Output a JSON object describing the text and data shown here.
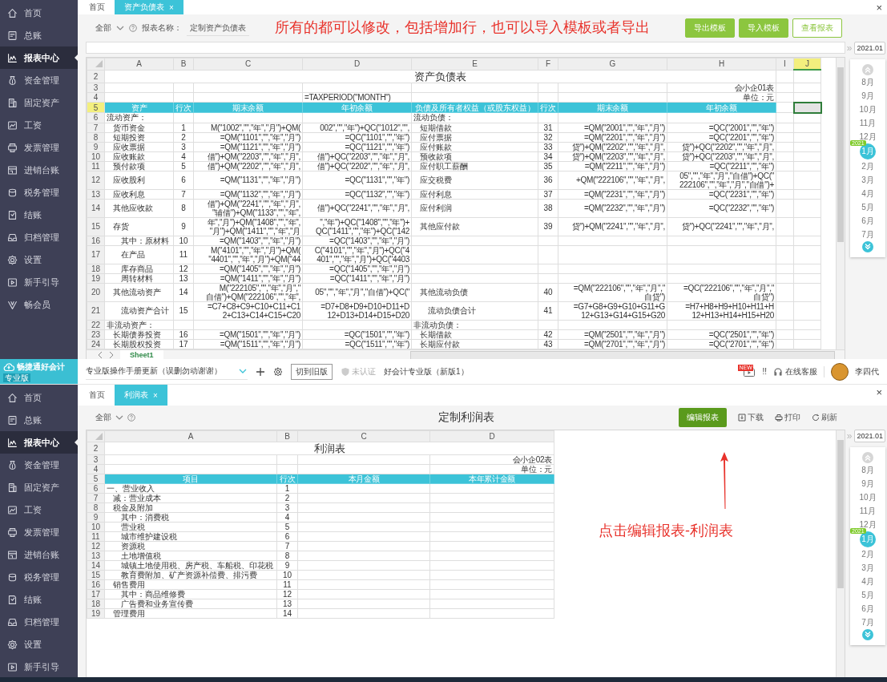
{
  "top": {
    "sidebar": [
      {
        "label": "首页",
        "selected": false
      },
      {
        "label": "总账",
        "selected": false
      },
      {
        "label": "报表中心",
        "selected": true
      },
      {
        "label": "资金管理",
        "selected": false
      },
      {
        "label": "固定资产",
        "selected": false
      },
      {
        "label": "工资",
        "selected": false
      },
      {
        "label": "发票管理",
        "selected": false
      },
      {
        "label": "进销台账",
        "selected": false
      },
      {
        "label": "税务管理",
        "selected": false
      },
      {
        "label": "结账",
        "selected": false
      },
      {
        "label": "归档管理",
        "selected": false
      },
      {
        "label": "设置",
        "selected": false
      },
      {
        "label": "新手引导",
        "selected": false
      },
      {
        "label": "畅会员",
        "selected": false
      }
    ],
    "tabs": [
      {
        "label": "首页",
        "selected": false
      },
      {
        "label": "资产负债表",
        "selected": true,
        "close": "×"
      }
    ],
    "close": "×",
    "toolbar": {
      "scope": "全部",
      "report_label": "报表名称：",
      "report_name": "定制资产负债表",
      "annotation": "所有的都可以修改，包括增加行，也可以导入模板或者导出",
      "buttons": [
        {
          "label": "导出模板",
          "kind": "solid"
        },
        {
          "label": "导入模板",
          "kind": "solid"
        },
        {
          "label": "查看报表",
          "kind": "outline"
        }
      ]
    },
    "sheet": {
      "tab": "Sheet1",
      "columns": [
        {
          "label": "A",
          "selected": false
        },
        {
          "label": "B",
          "selected": false
        },
        {
          "label": "C",
          "selected": false
        },
        {
          "label": "D",
          "selected": false
        },
        {
          "label": "E",
          "selected": false
        },
        {
          "label": "F",
          "selected": false
        },
        {
          "label": "G",
          "selected": false
        },
        {
          "label": "H",
          "selected": false
        },
        {
          "label": "I",
          "selected": false
        },
        {
          "label": "J",
          "selected": true
        }
      ],
      "rows": [
        {
          "num": "2",
          "kind": "title",
          "selected": false,
          "title": "资产负债表"
        },
        {
          "num": "3",
          "kind": "info",
          "selected": false,
          "cells": {
            "h": "会小企01表"
          }
        },
        {
          "num": "4",
          "kind": "info",
          "selected": false,
          "cells": {
            "d": "=TAXPERIOD(\"MONTH\")",
            "h": "单位：元"
          }
        },
        {
          "num": "5",
          "kind": "header",
          "selected": true,
          "cells": {
            "a": "资产",
            "b": "行次",
            "c": "期末余额",
            "d": "年初余额",
            "e": "负债及所有者权益（或股东权益）",
            "f": "行次",
            "g": "期末余额",
            "h": "年初余额"
          }
        },
        {
          "num": "6",
          "kind": "section",
          "selected": false,
          "cells": {
            "a": "流动资产：",
            "e": "流动负债："
          }
        },
        {
          "num": "7",
          "kind": "item",
          "selected": false,
          "cells": {
            "a": "货币资金",
            "b": "1",
            "c": "M(\"1002\",\"\",\"年\",\"月\")+QM(",
            "d": "002\",\"\",\"年\")+QC(\"1012\",\"\",",
            "e": "短期借款",
            "f": "31",
            "g": "=QM(\"2001\",\"\",\"年\",\"月\")",
            "h": "=QC(\"2001\",\"\",\"年\")"
          }
        },
        {
          "num": "8",
          "kind": "item",
          "selected": false,
          "cells": {
            "a": "短期投资",
            "b": "2",
            "c": "=QM(\"1101\",\"\",\"年\",\"月\")",
            "d": "=QC(\"1101\",\"\",\"年\")",
            "e": "应付票据",
            "f": "32",
            "g": "=QM(\"2201\",\"\",\"年\",\"月\")",
            "h": "=QC(\"2201\",\"\",\"年\")"
          }
        },
        {
          "num": "9",
          "kind": "item",
          "selected": false,
          "cells": {
            "a": "应收票据",
            "b": "3",
            "c": "=QM(\"1121\",\"\",\"年\",\"月\")",
            "d": "=QC(\"1121\",\"\",\"年\")",
            "e": "应付账款",
            "f": "33",
            "g": "贷\")+QM(\"2202\",\"\",\"年\",\"月\",",
            "h": "贷\")+QC(\"2202\",\"\",\"年\",\"月\","
          }
        },
        {
          "num": "10",
          "kind": "item",
          "selected": false,
          "cells": {
            "a": "应收账款",
            "b": "4",
            "c": "借\")+QM(\"2203\",\"\",\"年\",\"月\",",
            "d": "借\")+QC(\"2203\",\"\",\"年\",\"月\",",
            "e": "预收款项",
            "f": "34",
            "g": "贷\")+QM(\"2203\",\"\",\"年\",\"月\",",
            "h": "贷\")+QC(\"2203\",\"\",\"年\",\"月\","
          }
        },
        {
          "num": "11",
          "kind": "item",
          "selected": false,
          "cells": {
            "a": "预付款项",
            "b": "5",
            "c": "借\")+QM(\"2202\",\"\",\"年\",\"月\",",
            "d": "借\")+QC(\"2202\",\"\",\"年\",\"月\",",
            "e": "应付职工薪酬",
            "f": "35",
            "g": "=QM(\"2211\",\"\",\"年\",\"月\")",
            "h": "=QC(\"2211\",\"\",\"年\")"
          }
        },
        {
          "num": "12",
          "kind": "item",
          "selected": false,
          "cells": {
            "a": "应收股利",
            "b": "6",
            "c": "=QM(\"1131\",\"\",\"年\",\"月\")",
            "d": "=QC(\"1131\",\"\",\"年\")",
            "e": "应交税费",
            "f": "36",
            "g": "+QM(\"222106\",\"\",\"年\",\"月\",",
            "h": "05\",\"\",\"年\",\"月\",\"自借\")+QC(\"\n222106\",\"\",\"年\",\"月\",\"自借\")+"
          }
        },
        {
          "num": "13",
          "kind": "item",
          "selected": false,
          "cells": {
            "a": "应收利息",
            "b": "7",
            "c": "=QM(\"1132\",\"\",\"年\",\"月\")",
            "d": "=QC(\"1132\",\"\",\"年\")",
            "e": "应付利息",
            "f": "37",
            "g": "=QM(\"2231\",\"\",\"年\",\"月\")",
            "h": "=QC(\"2231\",\"\",\"年\")"
          }
        },
        {
          "num": "14",
          "kind": "item",
          "selected": false,
          "cells": {
            "a": "其他应收款",
            "b": "8",
            "c": "借\")+QM(\"2241\",\"\",\"年\",\"月\",\n\"辅借\")+QM(\"1133\",\"\",\"年\",",
            "d": "借\")+QC(\"2241\",\"\",\"年\",\"月\",",
            "e": "应付利润",
            "f": "38",
            "g": "=QM(\"2232\",\"\",\"年\",\"月\")",
            "h": "=QC(\"2232\",\"\",\"年\")"
          }
        },
        {
          "num": "15",
          "kind": "item",
          "selected": false,
          "cells": {
            "a": "存货",
            "b": "9",
            "c": "年\",\"月\")+QM(\"1408\",\"\",\"年\",\n\"月\")+QM(\"1411\",\"\",\"年\",\"月",
            "d": "\",\"年\")+QC(\"1408\",\"\",\"年\")+\nQC(\"1411\",\"\",\"年\")+QC(\"142",
            "e": "其他应付款",
            "f": "39",
            "g": "贷\")+QM(\"2241\",\"\",\"年\",\"月\",",
            "h": "贷\")+QC(\"2241\",\"\",\"年\",\"月\","
          }
        },
        {
          "num": "16",
          "kind": "subitem",
          "selected": false,
          "cells": {
            "a": "其中：原材料",
            "b": "10",
            "c": "=QM(\"1403\",\"\",\"年\",\"月\")",
            "d": "=QC(\"1403\",\"\",\"年\",\"月\")"
          }
        },
        {
          "num": "17",
          "kind": "subitem",
          "selected": false,
          "cells": {
            "a": "在产品",
            "b": "11",
            "c": "M(\"4101\",\"\",\"年\",\"月\")+QM(\n\"4401\",\"\",\"年\",\"月\")+QM(\"44",
            "d": "C(\"4101\",\"\",\"年\",\"月\")+QC(\"4\n401\",\"\",\"年\",\"月\")+QC(\"4403"
          }
        },
        {
          "num": "18",
          "kind": "subitem",
          "selected": false,
          "cells": {
            "a": "库存商品",
            "b": "12",
            "c": "=QM(\"1405\",\"\",\"年\",\"月\")",
            "d": "=QC(\"1405\",\"\",\"年\",\"月\")"
          }
        },
        {
          "num": "19",
          "kind": "subitem",
          "selected": false,
          "cells": {
            "a": "周转材料",
            "b": "13",
            "c": "=QM(\"1411\",\"\",\"年\",\"月\")",
            "d": "=QC(\"1411\",\"\",\"年\",\"月\")"
          }
        },
        {
          "num": "20",
          "kind": "item",
          "selected": false,
          "cells": {
            "a": "其他流动资产",
            "b": "14",
            "c": "M(\"222105\",\"\",\"年\",\"月\",\"\n自借\")+QM(\"222106\",\"\",\"年\",",
            "d": "05\",\"\",\"年\",\"月\",\"自借\")+QC(\"",
            "e": "其他流动负债",
            "f": "40",
            "g": "=QM(\"222106\",\"\",\"年\",\"月\",\"\n自贷\")",
            "h": "=QC(\"222106\",\"\",\"年\",\"月\",\"\n自贷\")"
          }
        },
        {
          "num": "21",
          "kind": "subitem",
          "selected": false,
          "cells": {
            "a": "流动资产合计",
            "b": "15",
            "c": "=C7+C8+C9+C10+C11+C1\n2+C13+C14+C15+C20",
            "d": "=D7+D8+D9+D10+D11+D\n12+D13+D14+D15+D20",
            "e": "流动负债合计",
            "f": "41",
            "g": "=G7+G8+G9+G10+G11+G\n12+G13+G14+G15+G20",
            "h": "=H7+H8+H9+H10+H11+H\n12+H13+H14+H15+H20"
          }
        },
        {
          "num": "22",
          "kind": "section",
          "selected": false,
          "cells": {
            "a": "非流动资产：",
            "e": "非流动负债："
          }
        },
        {
          "num": "23",
          "kind": "item",
          "selected": false,
          "cells": {
            "a": "长期债券投资",
            "b": "16",
            "c": "=QM(\"1501\",\"\",\"年\",\"月\")",
            "d": "=QC(\"1501\",\"\",\"年\")",
            "e": "长期借款",
            "f": "42",
            "g": "=QM(\"2501\",\"\",\"年\",\"月\")",
            "h": "=QC(\"2501\",\"\",\"年\")"
          }
        },
        {
          "num": "24",
          "kind": "item",
          "selected": false,
          "cells": {
            "a": "长期股权投资",
            "b": "17",
            "c": "=QM(\"1511\",\"\",\"年\",\"月\")",
            "d": "=QC(\"1511\",\"\",\"年\")",
            "e": "长期应付款",
            "f": "43",
            "g": "=QM(\"2701\",\"\",\"年\",\"月\")",
            "h": "=QC(\"2701\",\"\",\"年\")"
          }
        }
      ]
    },
    "date_panel": {
      "expand": "»",
      "period": "2021.01",
      "months": [
        {
          "label": "8月",
          "selected": false
        },
        {
          "label": "9月",
          "selected": false
        },
        {
          "label": "10月",
          "selected": false
        },
        {
          "label": "11月",
          "selected": false
        },
        {
          "label": "12月",
          "selected": false
        },
        {
          "label": "1月",
          "selected": true,
          "badge": "2021"
        },
        {
          "label": "2月",
          "selected": false
        },
        {
          "label": "3月",
          "selected": false
        },
        {
          "label": "4月",
          "selected": false
        },
        {
          "label": "5月",
          "selected": false
        },
        {
          "label": "6月",
          "selected": false
        },
        {
          "label": "7月",
          "selected": false
        }
      ]
    }
  },
  "bottom": {
    "header": {
      "logo_title": "畅捷通好会计",
      "edition": "专业版",
      "company": "专业版操作手册更新（误删勿动谢谢）",
      "switch_button": "切到旧版",
      "cert_status": "未认证",
      "product": "好会计专业版（新版1）",
      "new_badge": "NEW",
      "alert": "!!",
      "support": "在线客服",
      "user": "李四代"
    },
    "sidebar": [
      {
        "label": "首页",
        "selected": false
      },
      {
        "label": "总账",
        "selected": false
      },
      {
        "label": "报表中心",
        "selected": true
      },
      {
        "label": "资金管理",
        "selected": false
      },
      {
        "label": "固定资产",
        "selected": false
      },
      {
        "label": "工资",
        "selected": false
      },
      {
        "label": "发票管理",
        "selected": false
      },
      {
        "label": "进销台账",
        "selected": false
      },
      {
        "label": "税务管理",
        "selected": false
      },
      {
        "label": "结账",
        "selected": false
      },
      {
        "label": "归档管理",
        "selected": false
      },
      {
        "label": "设置",
        "selected": false
      },
      {
        "label": "新手引导",
        "selected": false
      }
    ],
    "tabs": [
      {
        "label": "首页",
        "selected": false
      },
      {
        "label": "利润表",
        "selected": true,
        "close": "×"
      }
    ],
    "close": "×",
    "toolbar": {
      "scope": "全部",
      "title": "定制利润表",
      "edit_button": "编辑报表",
      "actions": [
        {
          "label": "下载",
          "kind": "download"
        },
        {
          "label": "打印",
          "kind": "print"
        },
        {
          "label": "刷新",
          "kind": "refresh"
        }
      ]
    },
    "annotation": "点击编辑报表-利润表",
    "sheet": {
      "columns": [
        {
          "label": "A",
          "selected": false
        },
        {
          "label": "B",
          "selected": false
        },
        {
          "label": "C",
          "selected": false
        },
        {
          "label": "D",
          "selected": false
        }
      ],
      "rows": [
        {
          "num": "2",
          "kind": "title",
          "selected": false,
          "title": "利润表"
        },
        {
          "num": "3",
          "kind": "info",
          "selected": false,
          "cells": {
            "d": "会小企02表"
          }
        },
        {
          "num": "4",
          "kind": "info",
          "selected": false,
          "cells": {
            "d": "单位：元"
          }
        },
        {
          "num": "5",
          "kind": "header",
          "selected": false,
          "cells": {
            "a": "项目",
            "b": "行次",
            "c": "本月金额",
            "d": "本年累计金额"
          }
        },
        {
          "num": "6",
          "kind": "section",
          "selected": false,
          "cells": {
            "a": "一、营业收入",
            "b": "1"
          }
        },
        {
          "num": "7",
          "kind": "item",
          "selected": false,
          "cells": {
            "a": "减：营业成本",
            "b": "2"
          }
        },
        {
          "num": "8",
          "kind": "item",
          "selected": false,
          "cells": {
            "a": "税金及附加",
            "b": "3"
          }
        },
        {
          "num": "9",
          "kind": "subitem",
          "selected": false,
          "cells": {
            "a": "其中：消费税",
            "b": "4"
          }
        },
        {
          "num": "10",
          "kind": "subitem",
          "selected": false,
          "cells": {
            "a": "营业税",
            "b": "5"
          }
        },
        {
          "num": "11",
          "kind": "subitem",
          "selected": false,
          "cells": {
            "a": "城市维护建设税",
            "b": "6"
          }
        },
        {
          "num": "12",
          "kind": "subitem",
          "selected": false,
          "cells": {
            "a": "资源税",
            "b": "7"
          }
        },
        {
          "num": "13",
          "kind": "subitem",
          "selected": false,
          "cells": {
            "a": "土地增值税",
            "b": "8"
          }
        },
        {
          "num": "14",
          "kind": "subitem",
          "selected": false,
          "cells": {
            "a": "城镇土地使用税、房产税、车船税、印花税",
            "b": "9"
          }
        },
        {
          "num": "15",
          "kind": "subitem",
          "selected": false,
          "cells": {
            "a": "教育费附加、矿产资源补偿费、排污费",
            "b": "10"
          }
        },
        {
          "num": "16",
          "kind": "item",
          "selected": false,
          "cells": {
            "a": "销售费用",
            "b": "11"
          }
        },
        {
          "num": "17",
          "kind": "subitem",
          "selected": false,
          "cells": {
            "a": "其中：商品维修费",
            "b": "12"
          }
        },
        {
          "num": "18",
          "kind": "subitem",
          "selected": false,
          "cells": {
            "a": "广告费和业务宣传费",
            "b": "13"
          }
        },
        {
          "num": "19",
          "kind": "item",
          "selected": false,
          "cells": {
            "a": "管理费用",
            "b": "14"
          }
        }
      ]
    },
    "date_panel": {
      "expand": "»",
      "period": "2021.01",
      "months": [
        {
          "label": "8月",
          "selected": false
        },
        {
          "label": "9月",
          "selected": false
        },
        {
          "label": "10月",
          "selected": false
        },
        {
          "label": "11月",
          "selected": false
        },
        {
          "label": "12月",
          "selected": false
        },
        {
          "label": "1月",
          "selected": true,
          "badge": "2021"
        },
        {
          "label": "2月",
          "selected": false
        },
        {
          "label": "3月",
          "selected": false
        },
        {
          "label": "4月",
          "selected": false
        },
        {
          "label": "5月",
          "selected": false
        },
        {
          "label": "6月",
          "selected": false
        },
        {
          "label": "7月",
          "selected": false
        }
      ]
    }
  }
}
